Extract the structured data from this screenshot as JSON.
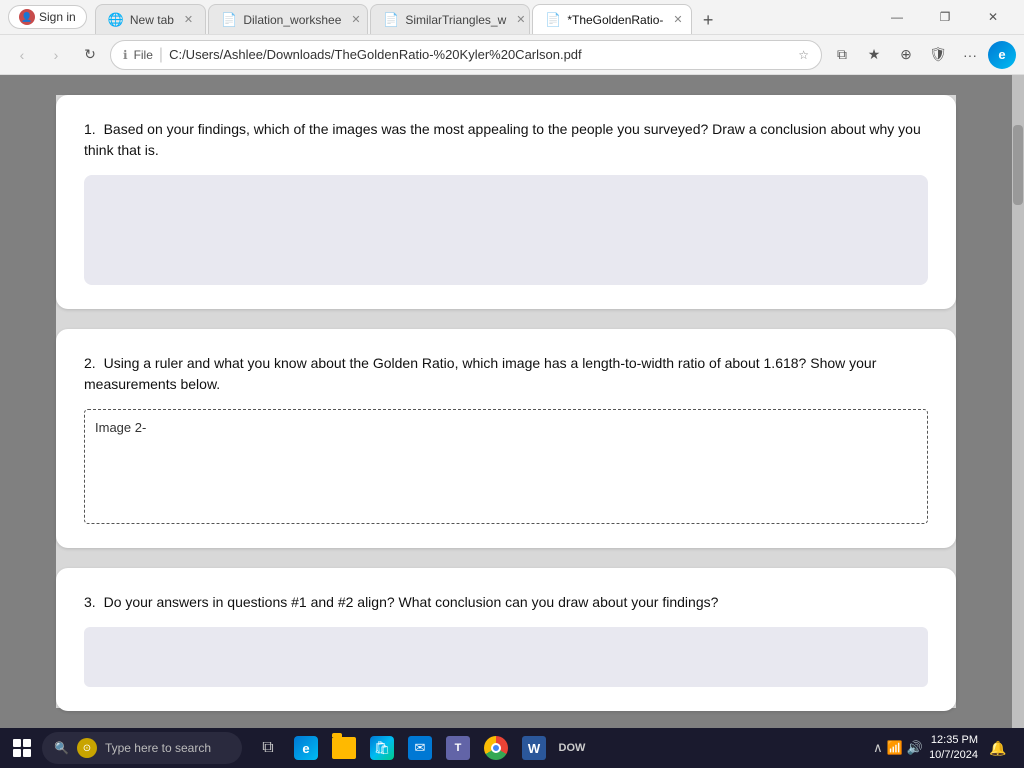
{
  "browser": {
    "title": "Edge Browser",
    "tabs": [
      {
        "id": "newtab",
        "label": "New tab",
        "active": false,
        "closeable": true,
        "icon": "📄"
      },
      {
        "id": "dilation",
        "label": "Dilation_workshee",
        "active": false,
        "closeable": true,
        "icon": "📕"
      },
      {
        "id": "similar",
        "label": "SimilarTriangles_w",
        "active": false,
        "closeable": true,
        "icon": "📕"
      },
      {
        "id": "goldenratio",
        "label": "*TheGoldenRatio-",
        "active": true,
        "closeable": true,
        "icon": "📕"
      }
    ],
    "url": "C:/Users/Ashlee/Downloads/TheGoldenRatio-%20Kyler%20Carlson.pdf",
    "sign_in_label": "Sign in"
  },
  "pdf": {
    "questions": [
      {
        "number": "1.",
        "text": "Based on your findings, which of the images was the most appealing to the people you surveyed? Draw a conclusion about why you think that is.",
        "answer_type": "shaded_box",
        "answer_value": ""
      },
      {
        "number": "2.",
        "text": "Using a ruler and what you know about the Golden Ratio, which image has a length-to-width ratio of about 1.618? Show your measurements below.",
        "answer_type": "dotted_box",
        "answer_value": "Image 2-"
      },
      {
        "number": "3.",
        "text": "Do your answers in questions #1 and #2 align? What conclusion can you draw about your findings?",
        "answer_type": "partial_shaded",
        "answer_value": ""
      }
    ]
  },
  "taskbar": {
    "search_placeholder": "Type here to search",
    "clock": {
      "time": "12:35 PM",
      "date": "10/7/2024"
    },
    "apps": [
      {
        "name": "task-view",
        "icon": "⊞"
      },
      {
        "name": "edge",
        "icon": "e"
      },
      {
        "name": "file-explorer",
        "icon": "📁"
      },
      {
        "name": "store",
        "icon": "🛍"
      },
      {
        "name": "mail",
        "icon": "✉"
      },
      {
        "name": "teams",
        "icon": "T"
      },
      {
        "name": "chrome",
        "icon": ""
      },
      {
        "name": "word",
        "icon": "W"
      },
      {
        "name": "dow",
        "label": "DOW"
      }
    ]
  }
}
